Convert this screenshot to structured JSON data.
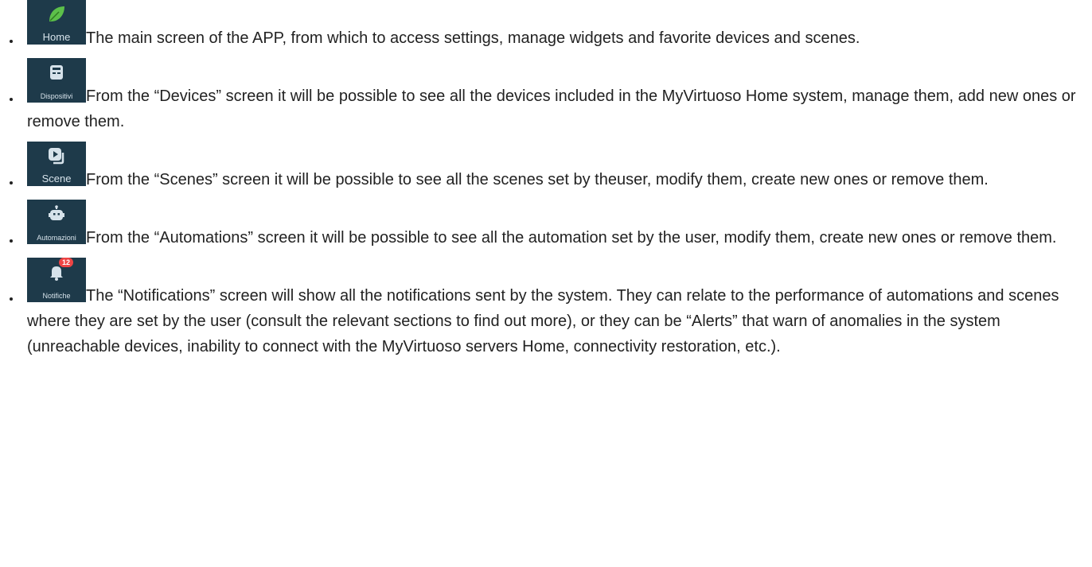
{
  "items": [
    {
      "icon_name": "leaf-icon",
      "icon_label": "Home",
      "text": "The main screen of the APP, from which to access settings, manage widgets and favorite devices and scenes."
    },
    {
      "icon_name": "devices-icon",
      "icon_label": "Dispositivi",
      "text": "From the “Devices” screen it will be possible to see all the devices included in the MyVirtuoso Home system, manage them, add new ones or remove them."
    },
    {
      "icon_name": "scene-icon",
      "icon_label": "Scene",
      "text": "From the “Scenes” screen it will be possible to see all the scenes set by theuser, modify them, create new ones or remove them."
    },
    {
      "icon_name": "robot-icon",
      "icon_label": "Automazioni",
      "text": "From the “Automations” screen it will be possible to see all the automation set by the user, modify them, create new ones or remove them."
    },
    {
      "icon_name": "bell-icon",
      "icon_label": "Notifiche",
      "badge": "12",
      "text": "The “Notifications” screen will show all the notifications sent by the system. They can relate to the performance of automations and scenes where they are set by the user (consult the relevant sections to find out more), or they can be “Alerts” that warn of anomalies in the system (unreachable devices, inability to connect with the MyVirtuoso servers Home, connectivity restoration, etc.)."
    }
  ],
  "colors": {
    "icon_bg": "#1e3a4a",
    "leaf": "#5cc04a",
    "badge": "#e44444"
  }
}
